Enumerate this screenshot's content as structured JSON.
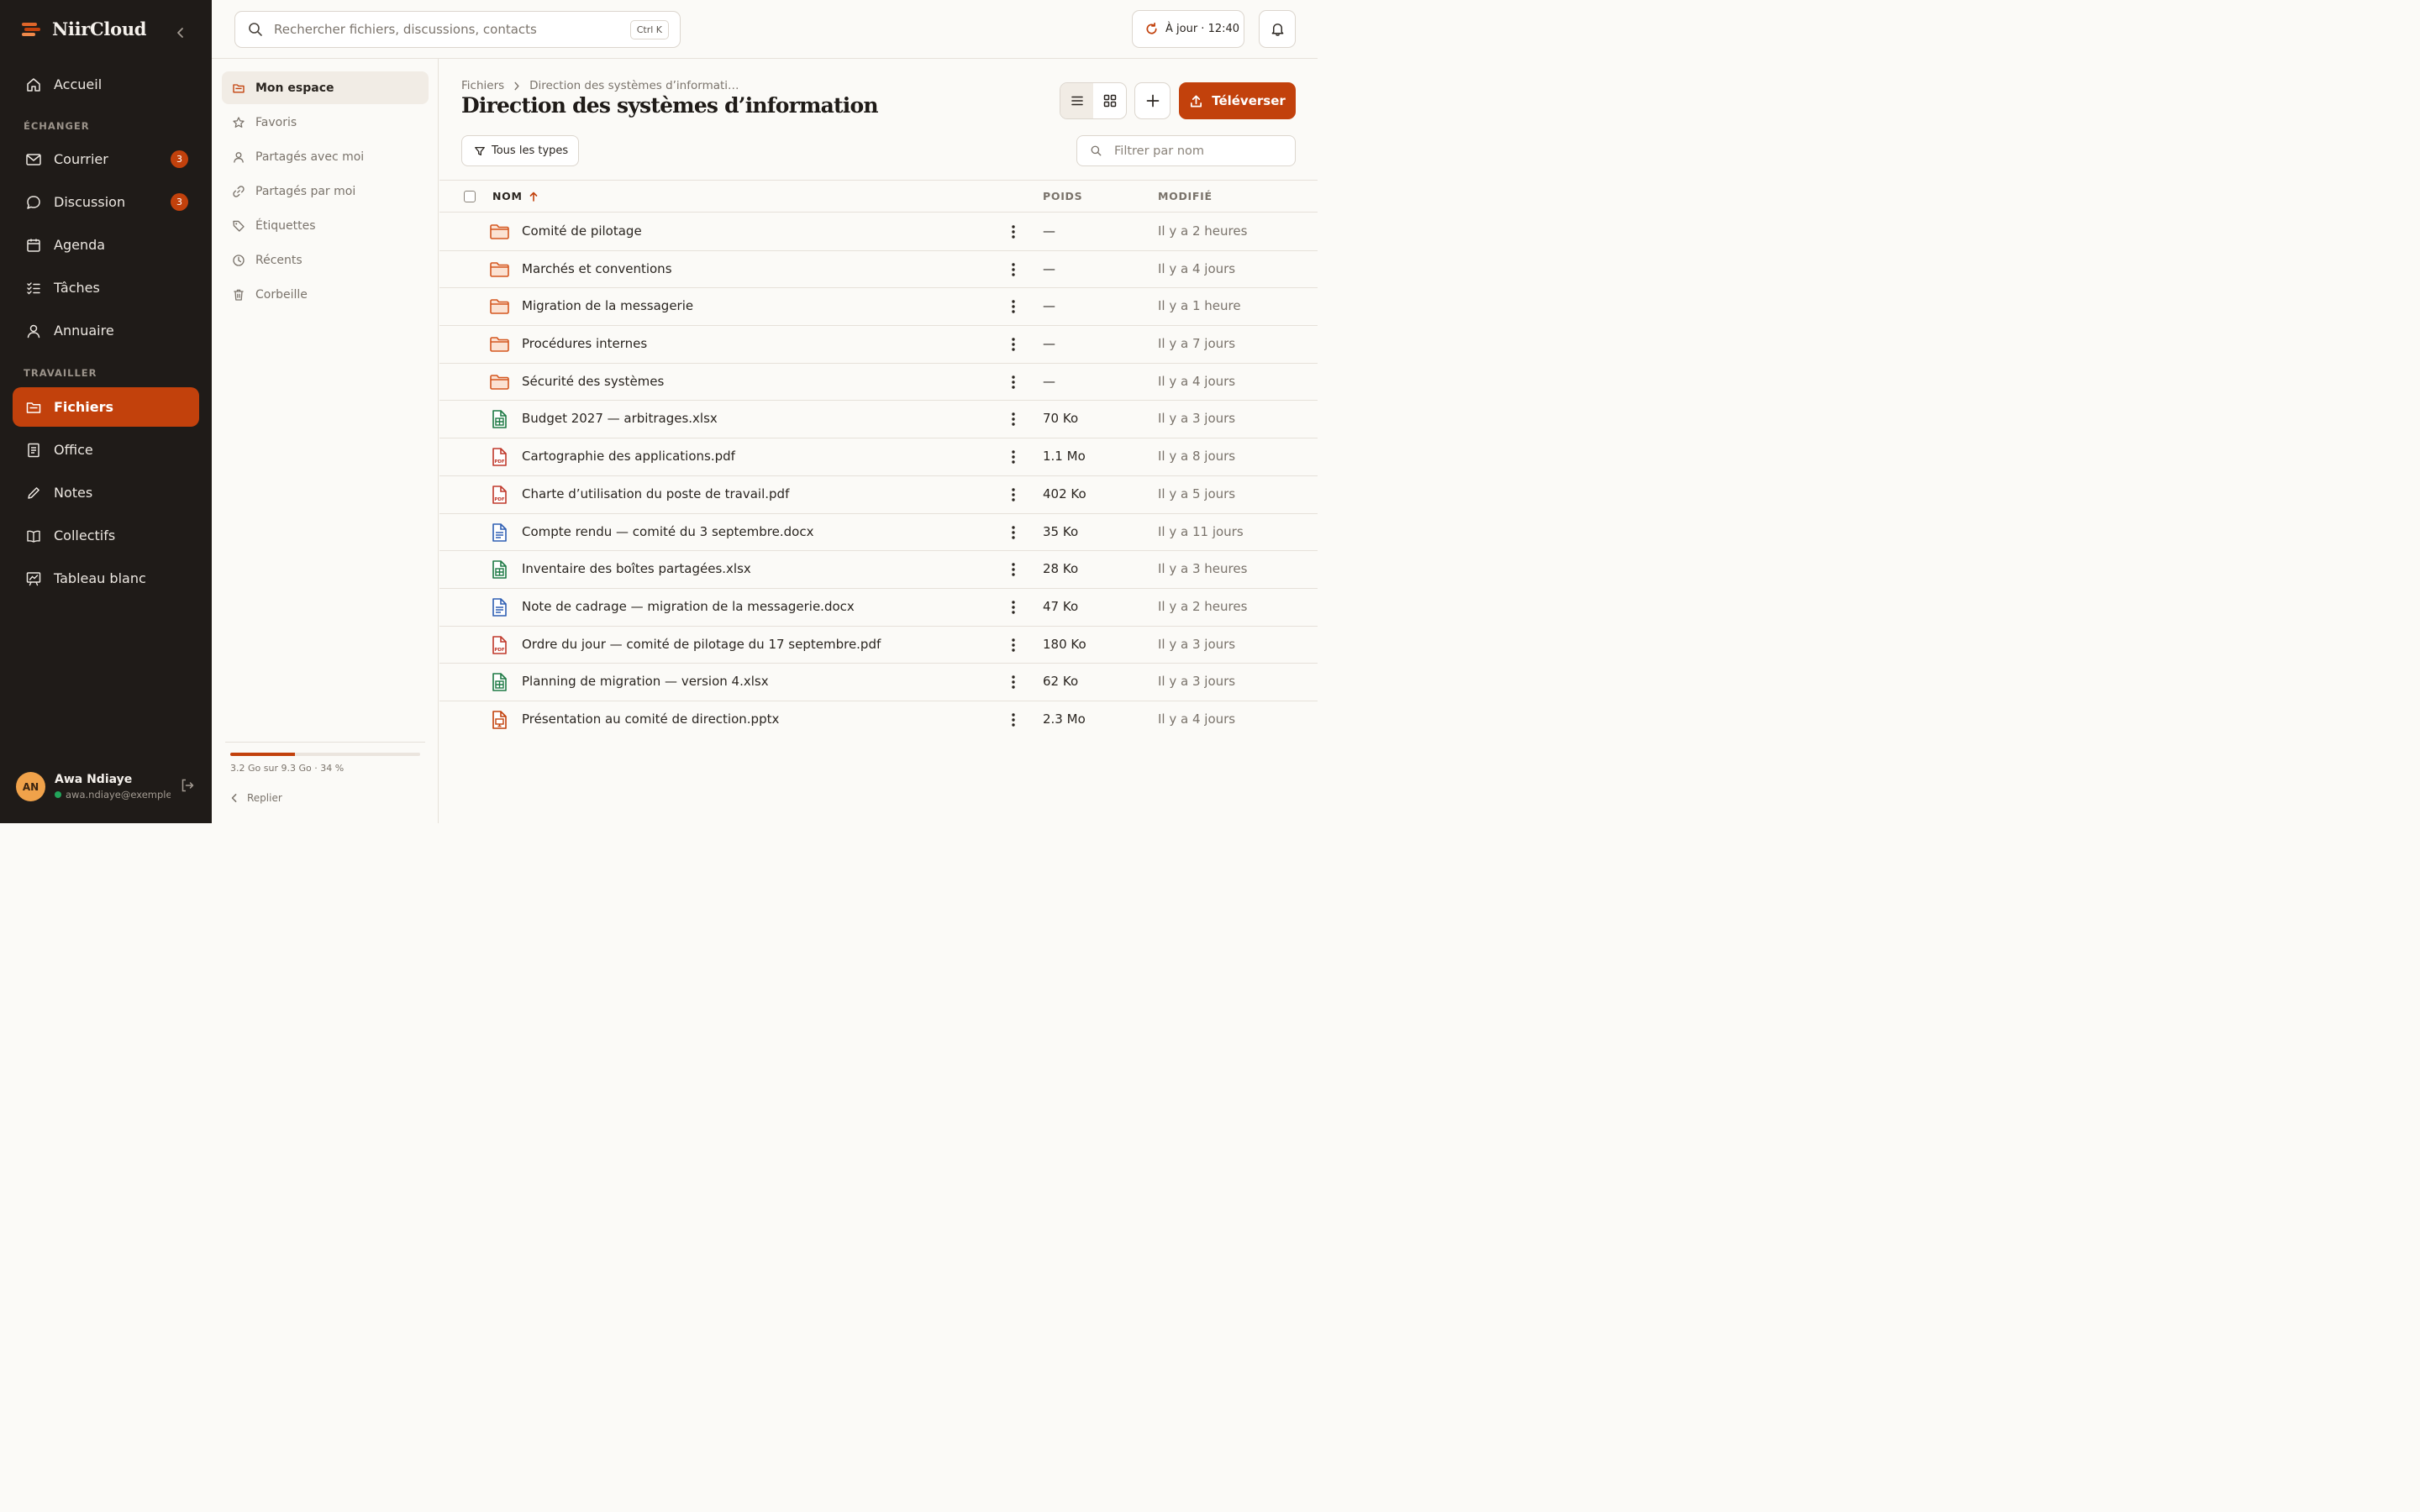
{
  "app": {
    "name": "NiirCloud"
  },
  "nav": {
    "items_top": [
      {
        "label": "Accueil",
        "icon": "home-icon"
      }
    ],
    "section_exchange": "ÉCHANGER",
    "items_exchange": [
      {
        "label": "Courrier",
        "icon": "mail-icon",
        "badge": "3"
      },
      {
        "label": "Discussion",
        "icon": "chat-icon",
        "badge": "3"
      },
      {
        "label": "Agenda",
        "icon": "calendar-icon"
      },
      {
        "label": "Tâches",
        "icon": "tasks-icon"
      },
      {
        "label": "Annuaire",
        "icon": "user-icon"
      }
    ],
    "section_work": "TRAVAILLER",
    "items_work": [
      {
        "label": "Fichiers",
        "icon": "folder-icon",
        "active": true
      },
      {
        "label": "Office",
        "icon": "document-icon"
      },
      {
        "label": "Notes",
        "icon": "pencil-icon"
      },
      {
        "label": "Collectifs",
        "icon": "book-icon"
      },
      {
        "label": "Tableau blanc",
        "icon": "whiteboard-icon"
      }
    ]
  },
  "user": {
    "initials": "AN",
    "name": "Awa Ndiaye",
    "email": "awa.ndiaye@exemple.s",
    "status_color": "#22a55a"
  },
  "search": {
    "placeholder": "Rechercher fichiers, discussions, contacts",
    "shortcut": "Ctrl K"
  },
  "sync": {
    "label": "À jour · 12:40"
  },
  "subnav": {
    "items": [
      {
        "label": "Mon espace",
        "icon": "folder-icon",
        "active": true
      },
      {
        "label": "Favoris",
        "icon": "star-icon"
      },
      {
        "label": "Partagés avec moi",
        "icon": "user-icon"
      },
      {
        "label": "Partagés par moi",
        "icon": "link-icon"
      },
      {
        "label": "Étiquettes",
        "icon": "tag-icon"
      },
      {
        "label": "Récents",
        "icon": "clock-icon"
      },
      {
        "label": "Corbeille",
        "icon": "trash-icon"
      }
    ],
    "storage": {
      "text": "3.2 Go sur 9.3 Go · 34 %",
      "fraction": 0.34
    },
    "fold_label": "Replier"
  },
  "breadcrumb": {
    "root": "Fichiers",
    "current": "Direction des systèmes d’informati…"
  },
  "page_title": "Direction des systèmes d’information",
  "toolbar": {
    "upload_label": "Téléverser",
    "types_label": "Tous les types",
    "filter_placeholder": "Filtrer par nom"
  },
  "table": {
    "headers": {
      "name": "NOM",
      "size": "POIDS",
      "modified": "MODIFIÉ"
    },
    "rows": [
      {
        "type": "folder",
        "name": "Comité de pilotage",
        "size": "—",
        "modified": "Il y a 2 heures"
      },
      {
        "type": "folder",
        "name": "Marchés et conventions",
        "size": "—",
        "modified": "Il y a 4 jours"
      },
      {
        "type": "folder",
        "name": "Migration de la messagerie",
        "size": "—",
        "modified": "Il y a 1 heure"
      },
      {
        "type": "folder",
        "name": "Procédures internes",
        "size": "—",
        "modified": "Il y a 7 jours"
      },
      {
        "type": "folder",
        "name": "Sécurité des systèmes",
        "size": "—",
        "modified": "Il y a 4 jours"
      },
      {
        "type": "xlsx",
        "name": "Budget 2027 — arbitrages.xlsx",
        "size": "70 Ko",
        "modified": "Il y a 3 jours"
      },
      {
        "type": "pdf",
        "name": "Cartographie des applications.pdf",
        "size": "1.1 Mo",
        "modified": "Il y a 8 jours"
      },
      {
        "type": "pdf",
        "name": "Charte d’utilisation du poste de travail.pdf",
        "size": "402 Ko",
        "modified": "Il y a 5 jours"
      },
      {
        "type": "docx",
        "name": "Compte rendu — comité du 3 septembre.docx",
        "size": "35 Ko",
        "modified": "Il y a 11 jours"
      },
      {
        "type": "xlsx",
        "name": "Inventaire des boîtes partagées.xlsx",
        "size": "28 Ko",
        "modified": "Il y a 3 heures"
      },
      {
        "type": "docx",
        "name": "Note de cadrage — migration de la messagerie.docx",
        "size": "47 Ko",
        "modified": "Il y a 2 heures"
      },
      {
        "type": "pdf",
        "name": "Ordre du jour — comité de pilotage du 17 septembre.pdf",
        "size": "180 Ko",
        "modified": "Il y a 3 jours"
      },
      {
        "type": "xlsx",
        "name": "Planning de migration — version 4.xlsx",
        "size": "62 Ko",
        "modified": "Il y a 3 jours"
      },
      {
        "type": "pptx",
        "name": "Présentation au comité de direction.pptx",
        "size": "2.3 Mo",
        "modified": "Il y a 4 jours"
      }
    ]
  },
  "colors": {
    "accent": "#c2410c",
    "sidebar_bg": "#1f1b18",
    "folder": "#d4561f",
    "xlsx": "#1e7a45",
    "pdf": "#c0392b",
    "docx": "#2f5fb3",
    "pptx": "#c2410c"
  }
}
